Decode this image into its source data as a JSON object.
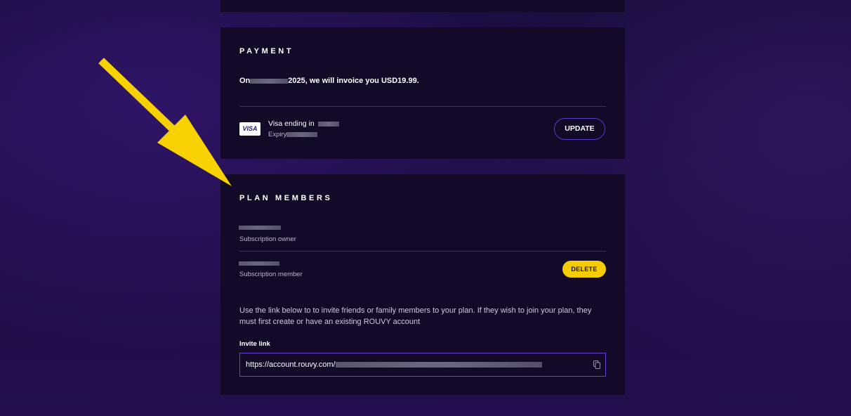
{
  "payment": {
    "title": "PAYMENT",
    "invoice_prefix": "On",
    "invoice_suffix": "2025, we will invoice you USD19.99.",
    "card_brand": "VISA",
    "card_label": "Visa ending in",
    "expiry_label": "Expiry",
    "update_label": "UPDATE"
  },
  "members": {
    "title": "PLAN MEMBERS",
    "owner_role": "Subscription owner",
    "member_role": "Subscription member",
    "delete_label": "DELETE",
    "description": "Use the link below to to invite friends or family members to your plan. If they wish to join your plan, they must first create or have an existing ROUVY account",
    "invite_label": "Invite link",
    "invite_value": "https://account.rouvy.com/"
  },
  "colors": {
    "background": "#1f0d44",
    "card": "#120a27",
    "accent_purple": "#5b38c9",
    "delete_yellow": "#f5cc00",
    "annotation_arrow": "#f7d200"
  },
  "icons": {
    "copy": "copy-icon",
    "annotation": "arrow-annotation"
  }
}
